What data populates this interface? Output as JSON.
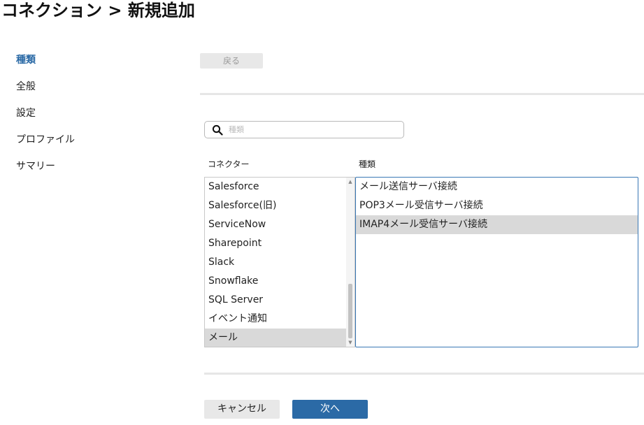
{
  "page": {
    "title": "コネクション > 新規追加"
  },
  "side_nav": {
    "items": [
      {
        "label": "種類",
        "active": true
      },
      {
        "label": "全般"
      },
      {
        "label": "設定"
      },
      {
        "label": "プロファイル"
      },
      {
        "label": "サマリー"
      }
    ]
  },
  "toolbar": {
    "back_label": "戻る"
  },
  "search": {
    "placeholder": "種類",
    "value": "",
    "icon": "search-icon"
  },
  "columns": {
    "connector_header": "コネクター",
    "kind_header": "種類"
  },
  "connectors": {
    "items": [
      "Salesforce",
      "Salesforce(旧)",
      "ServiceNow",
      "Sharepoint",
      "Slack",
      "Snowflake",
      "SQL Server",
      "イベント通知",
      "メール"
    ],
    "selected": "メール"
  },
  "kinds": {
    "items": [
      "メール送信サーバ接続",
      "POP3メール受信サーバ接続",
      "IMAP4メール受信サーバ接続"
    ],
    "selected": "IMAP4メール受信サーバ接続"
  },
  "footer": {
    "cancel_label": "キャンセル",
    "next_label": "次へ"
  },
  "colors": {
    "accent": "#2b6aa6",
    "selected_row": "#d9d9d9",
    "list_focus_border": "#3a78b5"
  }
}
